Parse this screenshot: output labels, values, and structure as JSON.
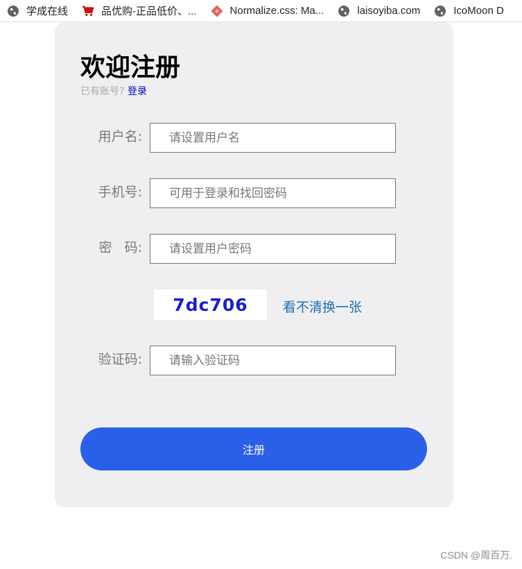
{
  "bookmarks": [
    {
      "label": "学成在线",
      "icon": "globe-icon"
    },
    {
      "label": "品优购-正品低价、...",
      "icon": "cart-icon"
    },
    {
      "label": "Normalize.css: Ma...",
      "icon": "diamond-icon"
    },
    {
      "label": "laisoyiba.com",
      "icon": "globe-icon"
    },
    {
      "label": "IcoMoon D",
      "icon": "globe-icon"
    }
  ],
  "form": {
    "title": "欢迎注册",
    "has_account_text": "已有账号?",
    "login_link": "登录",
    "fields": [
      {
        "label": "用户名:",
        "placeholder": "请设置用户名",
        "value": ""
      },
      {
        "label": "手机号:",
        "placeholder": "可用于登录和找回密码",
        "value": ""
      },
      {
        "label": "密   码:",
        "placeholder": "请设置用户密码",
        "value": ""
      },
      {
        "label": "验证码:",
        "placeholder": "请输入验证码",
        "value": ""
      }
    ],
    "captcha": {
      "code": "7dc706",
      "refresh_label": "看不清换一张"
    },
    "submit_label": "注册"
  },
  "watermark": "CSDN @周百万.",
  "colors": {
    "card_bg": "#efeff1",
    "button_bg": "#2a5fe8",
    "captcha_text": "#1a1ad6",
    "link": "#1e6fb0"
  }
}
